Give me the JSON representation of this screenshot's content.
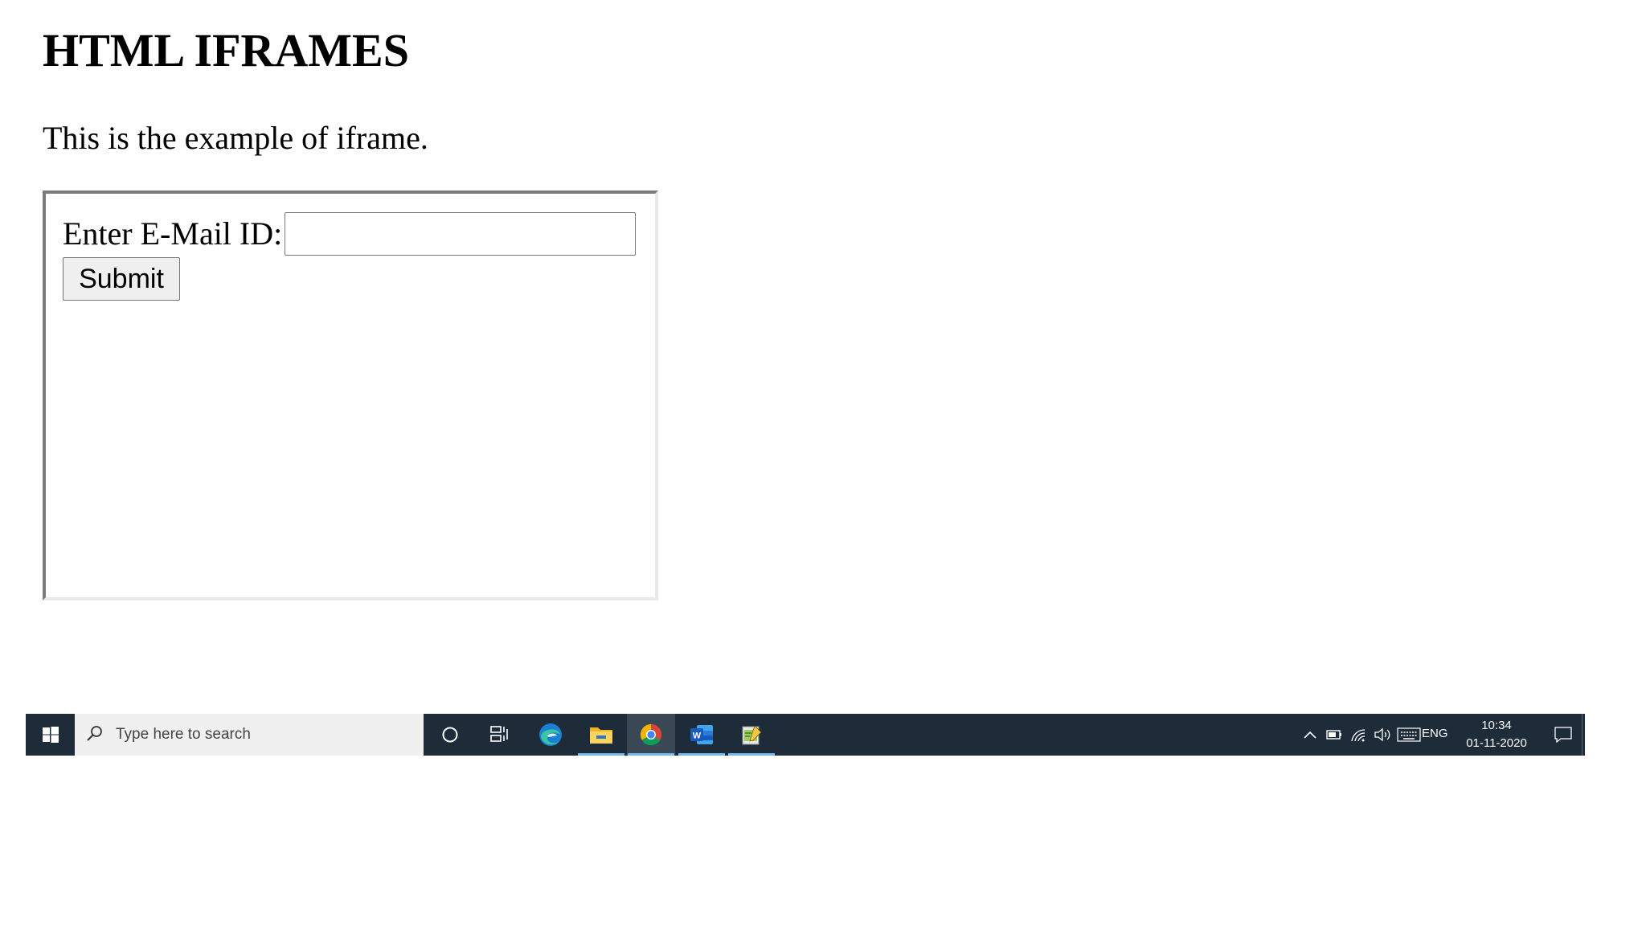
{
  "page": {
    "title": "HTML IFRAMES",
    "intro": "This is the example of iframe."
  },
  "iframe_form": {
    "email_label": "Enter E-Mail ID:",
    "email_value": "",
    "submit_label": "Submit"
  },
  "taskbar": {
    "search_placeholder": "Type here to search",
    "apps": [
      {
        "name": "cortana-icon",
        "active": false
      },
      {
        "name": "task-view-icon",
        "active": false
      },
      {
        "name": "edge-icon",
        "active": false
      },
      {
        "name": "file-explorer-icon",
        "active": true
      },
      {
        "name": "chrome-icon",
        "active": true
      },
      {
        "name": "word-icon",
        "active": true
      },
      {
        "name": "notepad-plus-icon",
        "active": true
      }
    ],
    "tray": {
      "language": "ENG",
      "time": "10:34",
      "date": "01-11-2020"
    },
    "colors": {
      "bar": "#1e2b38",
      "active_underline": "#76b9ed",
      "search_bg": "#f0f0f0"
    }
  }
}
